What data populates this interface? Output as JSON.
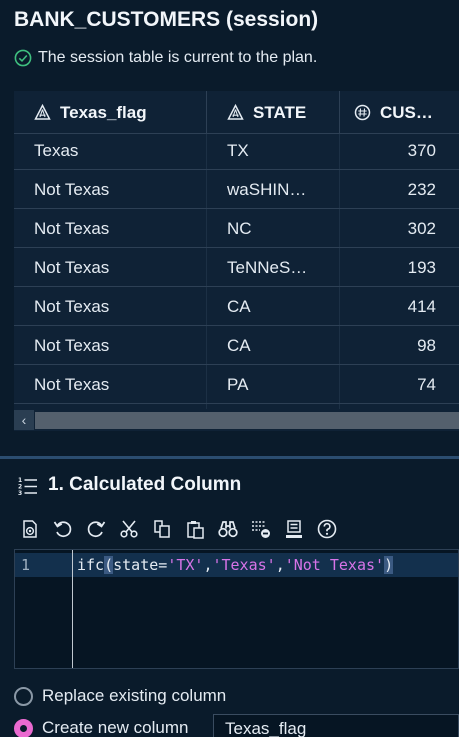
{
  "title": "BANK_CUSTOMERS (session)",
  "status": {
    "icon": "check-circle-icon",
    "text": "The session table is current to the plan.",
    "color": "#3fbf7f"
  },
  "table": {
    "columns": [
      {
        "label": "Texas_flag",
        "icon": "character-type-icon"
      },
      {
        "label": "STATE",
        "icon": "character-type-icon"
      },
      {
        "label": "CUS…",
        "icon": "numeric-type-icon"
      }
    ],
    "rows": [
      [
        "Texas",
        "TX",
        "370"
      ],
      [
        "Not Texas",
        "waSHIN…",
        "232"
      ],
      [
        "Not Texas",
        "NC",
        "302"
      ],
      [
        "Not Texas",
        "TeNNeS…",
        "193"
      ],
      [
        "Not Texas",
        "CA",
        "414"
      ],
      [
        "Not Texas",
        "CA",
        "98"
      ],
      [
        "Not Texas",
        "PA",
        "74"
      ]
    ]
  },
  "section": {
    "icon": "numbered-list-icon",
    "title": "1. Calculated Column"
  },
  "toolbar": [
    "run-icon",
    "undo-icon",
    "redo-icon",
    "cut-icon",
    "copy-icon",
    "paste-icon",
    "find-icon",
    "delete-lines-icon",
    "format-icon",
    "help-icon"
  ],
  "editor": {
    "line_number": "1",
    "code": {
      "fn": "ifc",
      "open": "(",
      "body_pre": "state=",
      "s1": "'TX'",
      "comma1": ",",
      "s2": "'Texas'",
      "comma2": ",",
      "s3": "'Not Texas'",
      "close": ")"
    }
  },
  "options": {
    "replace_label": "Replace existing column",
    "create_label": "Create new column",
    "selected": "create",
    "new_column_name": "Texas_flag"
  },
  "colors": {
    "accent": "#ea6ad0",
    "string": "#d774e8",
    "background": "#0a1b2b"
  }
}
